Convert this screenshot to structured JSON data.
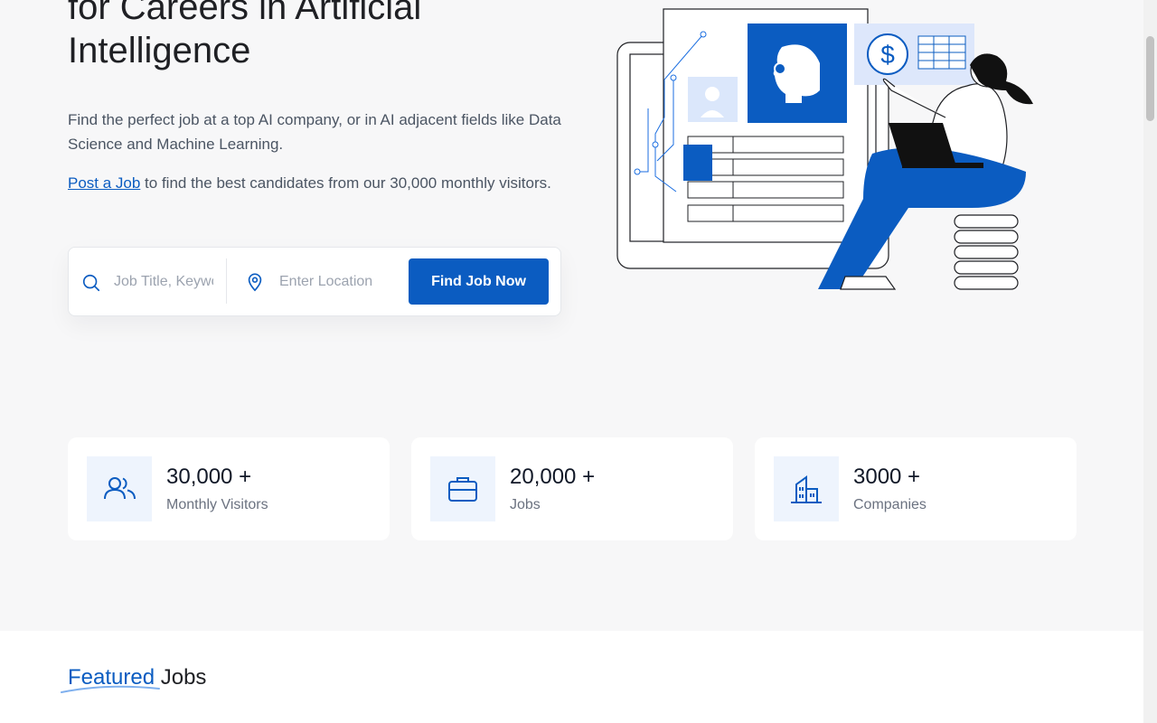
{
  "hero": {
    "headline_line1": "for Careers in Artificial",
    "headline_line2": "Intelligence",
    "description": "Find the perfect job at a top AI company, or in AI adjacent fields like Data Science and Machine Learning.",
    "post_link": "Post a Job",
    "post_text": " to find the best candidates from our 30,000 monthly visitors."
  },
  "search": {
    "query_placeholder": "Job Title, Keywords",
    "location_placeholder": "Enter Location",
    "button_label": "Find Job Now",
    "query_icon": "search-icon",
    "location_icon": "map-pin-icon"
  },
  "stats": [
    {
      "value": "30,000 +",
      "label": "Monthly Visitors",
      "icon": "users-icon"
    },
    {
      "value": "20,000 +",
      "label": "Jobs",
      "icon": "briefcase-icon"
    },
    {
      "value": "3000 +",
      "label": "Companies",
      "icon": "building-icon"
    }
  ],
  "featured": {
    "title_accent": "Featured",
    "title_rest": " Jobs"
  },
  "colors": {
    "accent": "#0b5cc1",
    "icon_bg": "#eef4fd",
    "page_bg": "#f7f7f8"
  }
}
